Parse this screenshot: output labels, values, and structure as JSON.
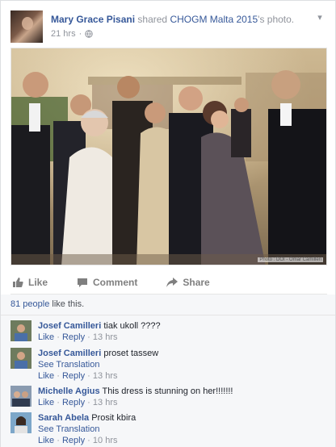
{
  "post": {
    "author": "Mary Grace Pisani",
    "verb": "shared",
    "page": "CHOGM Malta 2015",
    "suffix": "'s photo.",
    "time": "21 hrs",
    "dot": "·",
    "photo_credit": "Photo : DOI - Omar Camilleri"
  },
  "actions": {
    "like": "Like",
    "comment": "Comment",
    "share": "Share"
  },
  "likes": {
    "count_text": "81 people",
    "rest": " like this."
  },
  "comments": [
    {
      "author": "Josef Camilleri",
      "text": "tiak ukoll ????",
      "translation": "",
      "like": "Like",
      "reply": "Reply",
      "time": "13 hrs"
    },
    {
      "author": "Josef Camilleri",
      "text": "proset tassew",
      "translation": "See Translation",
      "like": "Like",
      "reply": "Reply",
      "time": "13 hrs"
    },
    {
      "author": "Michelle Agius",
      "text": "This dress is stunning on her!!!!!!!",
      "translation": "",
      "like": "Like",
      "reply": "Reply",
      "time": "13 hrs"
    },
    {
      "author": "Sarah Abela",
      "text": "Prosit kbira",
      "translation": "See Translation",
      "like": "Like",
      "reply": "Reply",
      "time": "10 hrs"
    }
  ],
  "separator": "·",
  "colors": {
    "link": "#365899",
    "muted": "#90949c",
    "bg": "#f6f7f9"
  },
  "icons": [
    "globe-icon",
    "chevron-down-icon",
    "like-icon",
    "comment-icon",
    "share-icon"
  ]
}
